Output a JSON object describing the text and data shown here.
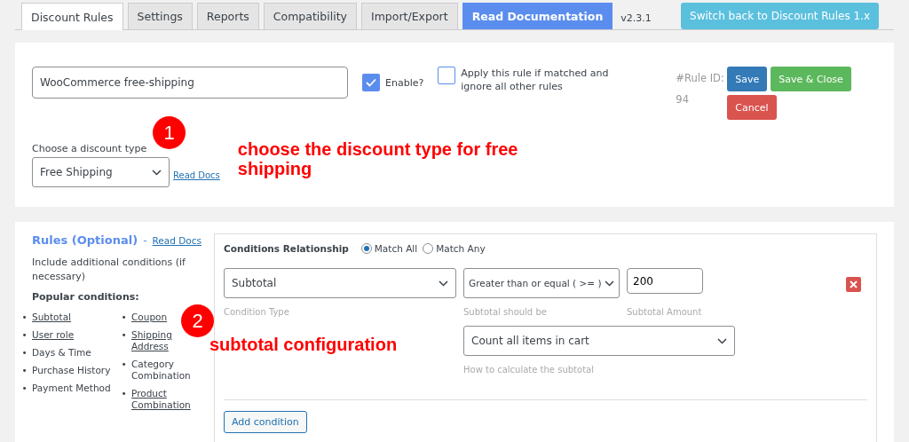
{
  "tabs": [
    {
      "label": "Discount Rules",
      "selected": true,
      "kind": "tab"
    },
    {
      "label": "Settings",
      "selected": false,
      "kind": "tab"
    },
    {
      "label": "Reports",
      "selected": false,
      "kind": "tab"
    },
    {
      "label": "Compatibility",
      "selected": false,
      "kind": "tab"
    },
    {
      "label": "Import/Export",
      "selected": false,
      "kind": "tab"
    },
    {
      "label": "Read Documentation",
      "selected": false,
      "kind": "doc"
    }
  ],
  "version": "v2.3.1",
  "switch_button": "Switch back to Discount Rules 1.x",
  "rule": {
    "name": "WooCommerce free-shipping",
    "enable": {
      "label": "Enable?",
      "checked": true
    },
    "exclusive": {
      "label": "Apply this rule if matched and ignore all other rules",
      "checked": false
    },
    "rule_id_label": "#Rule ID:",
    "rule_id": "94",
    "buttons": [
      {
        "label": "Save",
        "kind": "primary"
      },
      {
        "label": "Save & Close",
        "kind": "success"
      },
      {
        "label": "Cancel",
        "kind": "danger"
      }
    ],
    "discount_type_label": "Choose a discount type",
    "discount_type": "Free Shipping",
    "read_docs": "Read Docs"
  },
  "annotations": [
    {
      "number": "1",
      "text": "choose the discount type for free shipping"
    },
    {
      "number": "2",
      "text": "subtotal configuration"
    }
  ],
  "rules": {
    "title": "Rules (Optional)",
    "separator": "-",
    "read_docs": "Read Docs",
    "description": "Include additional conditions (if necessary)",
    "popular_title": "Popular conditions:",
    "marker": "•",
    "popular_columns": [
      [
        {
          "label": "Subtotal",
          "link": true
        },
        {
          "label": "User role",
          "link": true
        },
        {
          "label": "Days & Time",
          "link": false
        },
        {
          "label": "Purchase History",
          "link": false
        },
        {
          "label": "Payment Method",
          "link": false
        }
      ],
      [
        {
          "label": "Coupon",
          "link": true
        },
        {
          "label": "Shipping Address",
          "link": true
        },
        {
          "label": "Category Combination",
          "link": false
        },
        {
          "label": "Product Combination",
          "link": true
        }
      ]
    ],
    "relationship_label": "Conditions Relationship",
    "relationship_options": [
      {
        "label": "Match All",
        "selected": true
      },
      {
        "label": "Match Any",
        "selected": false
      }
    ],
    "condition": {
      "type": "Subtotal",
      "type_hint": "Condition Type",
      "operator": "Greater than or equal ( >= )",
      "operator_hint": "Subtotal should be",
      "amount": "200",
      "amount_hint": "Subtotal Amount",
      "calculate": "Count all items in cart",
      "calculate_hint": "How to calculate the subtotal"
    },
    "add_condition": "Add condition"
  }
}
